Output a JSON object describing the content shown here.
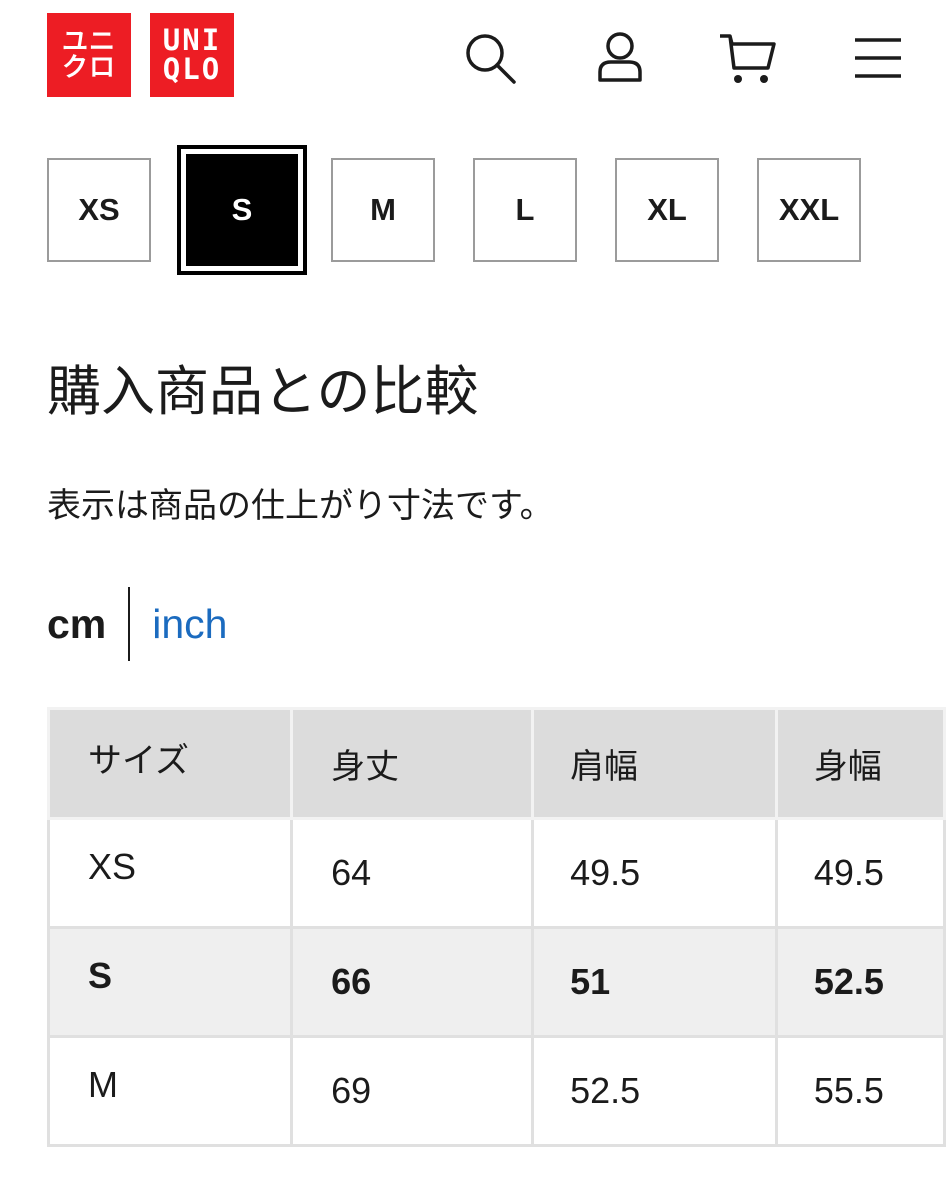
{
  "header": {
    "logo_jp_line1": "ユニ",
    "logo_jp_line2": "クロ",
    "logo_en_line1": "UNI",
    "logo_en_line2": "QLO",
    "brand_color": "#ed1d24",
    "icons": [
      "search-icon",
      "account-icon",
      "cart-icon",
      "menu-icon"
    ]
  },
  "size_selector": {
    "sizes": [
      "XS",
      "S",
      "M",
      "L",
      "XL",
      "XXL"
    ],
    "selected": "S"
  },
  "comparison": {
    "title": "購入商品との比較",
    "note": "表示は商品の仕上がり寸法です。",
    "unit_active": "cm",
    "unit_other": "inch",
    "link_color": "#1b6bbf"
  },
  "table": {
    "headers": [
      "サイズ",
      "身丈",
      "肩幅",
      "身幅"
    ],
    "rows": [
      {
        "size": "XS",
        "length": "64",
        "shoulder": "49.5",
        "width": "49.5"
      },
      {
        "size": "S",
        "length": "66",
        "shoulder": "51",
        "width": "52.5"
      },
      {
        "size": "M",
        "length": "69",
        "shoulder": "52.5",
        "width": "55.5"
      }
    ],
    "highlighted_row": "S"
  }
}
